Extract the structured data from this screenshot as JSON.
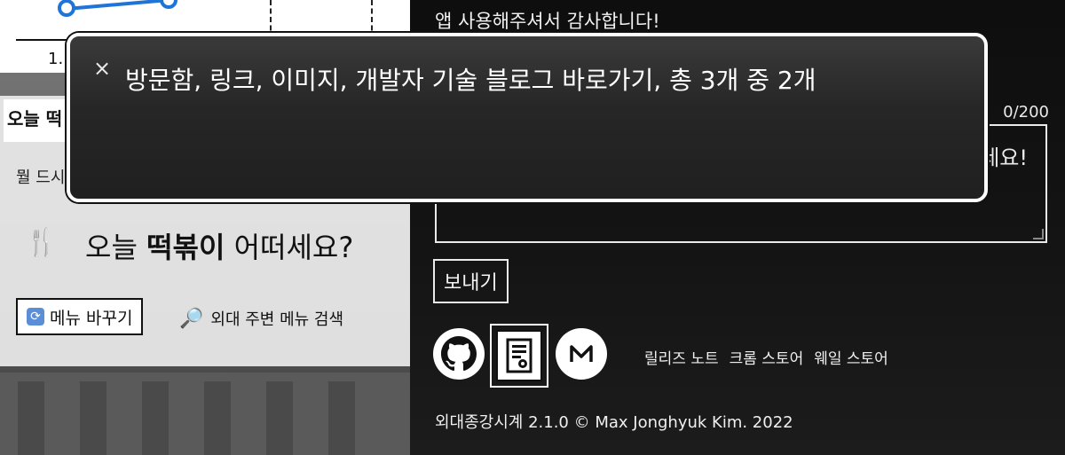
{
  "chart": {
    "tick_label": "1."
  },
  "food": {
    "today_label": "오늘 떡",
    "world_label": "뭘 드시",
    "suggestion_prefix": "오늘 ",
    "suggestion_food": "떡볶이",
    "suggestion_suffix": " 어떠세요?",
    "change_button": "메뉴 바꾸기",
    "search_link": "외대 주변 메뉴 검색"
  },
  "feedback": {
    "thanks_text": "앱 사용해주셔서 감사합니다!",
    "counter": "0/200",
    "textarea_visible_text": "세요!",
    "send_button": "보내기"
  },
  "links": {
    "icons": [
      "github-icon",
      "blog-icon",
      "medium-icon"
    ],
    "text_links": [
      "릴리즈 노트",
      "크롬 스토어",
      "웨일 스토어"
    ]
  },
  "footer": {
    "copyright": "외대종강시계 2.1.0 © Max Jonghyuk Kim. 2022"
  },
  "screen_reader": {
    "close_symbol": "×",
    "announcement": "방문함, 링크, 이미지, 개발자 기술 블로그 바로가기, 총 3개 중 2개"
  },
  "colors": {
    "panel_bg": "#111111",
    "overlay_bg": "#262626",
    "chart_line": "#1e74d8"
  }
}
